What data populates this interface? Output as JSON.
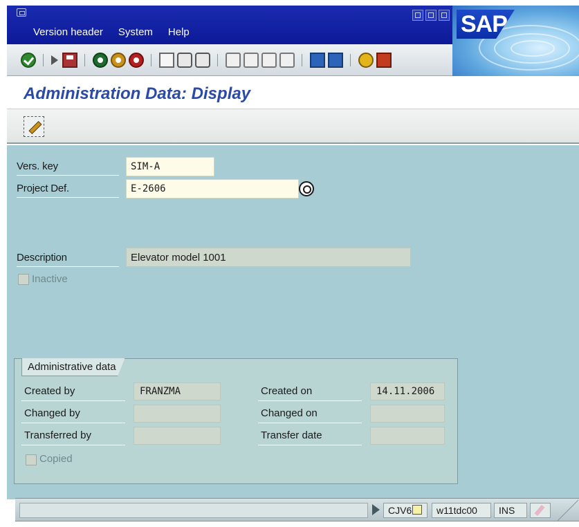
{
  "menubar": {
    "items": [
      "Version header",
      "System",
      "Help"
    ]
  },
  "logo": {
    "text": "SAP"
  },
  "title": "Administration Data: Display",
  "form": {
    "vers_key": {
      "label": "Vers. key",
      "value": "SIM-A"
    },
    "project_def": {
      "label": "Project Def.",
      "value": "E-2606"
    },
    "description": {
      "label": "Description",
      "value": "Elevator model 1001"
    },
    "inactive": {
      "label": "Inactive",
      "checked": false
    }
  },
  "admin_group": {
    "title": "Administrative data",
    "created_by": {
      "label": "Created by",
      "value": "FRANZMA"
    },
    "created_on": {
      "label": "Created on",
      "value": "14.11.2006"
    },
    "changed_by": {
      "label": "Changed by",
      "value": ""
    },
    "changed_on": {
      "label": "Changed on",
      "value": ""
    },
    "transferred_by": {
      "label": "Transferred by",
      "value": ""
    },
    "transfer_date": {
      "label": "Transfer date",
      "value": ""
    },
    "copied": {
      "label": "Copied",
      "checked": false
    }
  },
  "status": {
    "transaction": "CJV6",
    "server": "w11tdc00",
    "mode": "INS"
  },
  "colors": {
    "menubar": "#0c1a98",
    "title": "#2a4aa6",
    "content_bg": "#a7ccd4"
  },
  "icons": [
    "app-icon",
    "minimize-icon",
    "restore-icon",
    "close-icon",
    "check-icon",
    "command-field-icon",
    "save-icon",
    "back-icon",
    "exit-icon",
    "cancel-icon",
    "print-icon",
    "find-icon",
    "find-next-icon",
    "first-page-icon",
    "previous-page-icon",
    "next-page-icon",
    "last-page-icon",
    "new-session-icon",
    "shortcut-icon",
    "help-icon",
    "layout-icon",
    "change-mode-icon",
    "value-help-icon"
  ]
}
